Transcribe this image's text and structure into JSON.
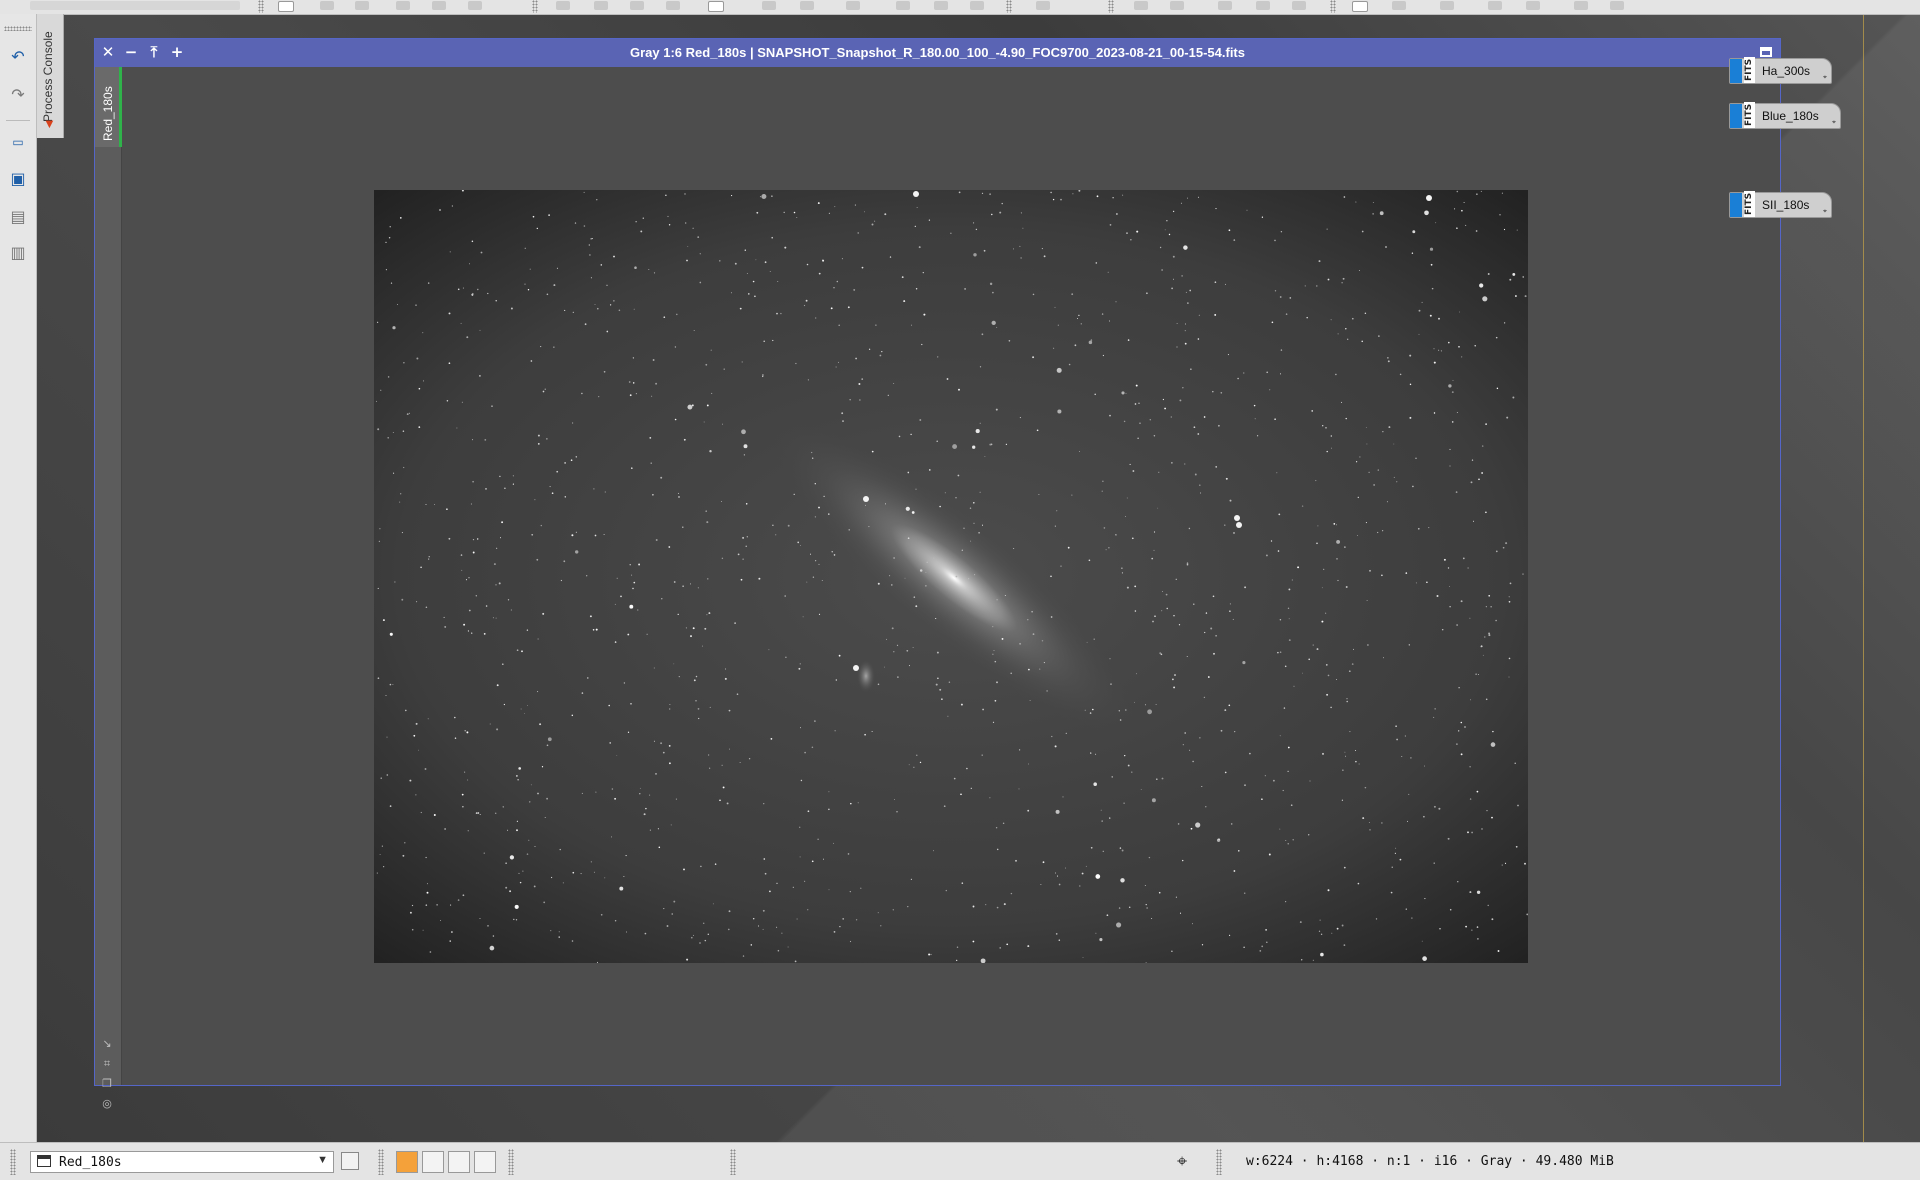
{
  "app": {
    "process_console_label": "Process Console"
  },
  "icons": {
    "undo": "undo-icon",
    "redo": "redo-icon",
    "close": "close-icon",
    "minimize": "minimize-icon",
    "shade": "shade-icon",
    "maximize": "maximize-icon",
    "cursor": "crosshair-icon"
  },
  "image_window": {
    "title": "Gray 1:6 Red_180s | SNAPSHOT_Snapshot_R_180.00_100_-4.90_FOC9700_2023-08-21_00-15-54.fits",
    "view_tab_label": "Red_180s",
    "title_bar_color": "#5a64b4",
    "active_tab_color": "#2fb34a"
  },
  "desktop_icons": [
    {
      "label": "Ha_300s",
      "badge": "FITS"
    },
    {
      "label": "Blue_180s",
      "badge": "FITS"
    },
    {
      "label": "SII_180s",
      "badge": "FITS"
    }
  ],
  "status_bar": {
    "view_selector_value": "Red_180s",
    "image_info": "w:6224 · h:4168 · n:1 · i16 · Gray · 49.480 MiB",
    "swatch_colors": [
      "#f4a13a",
      "#f3f3f3",
      "#f3f3f3",
      "#f3f3f3"
    ]
  }
}
